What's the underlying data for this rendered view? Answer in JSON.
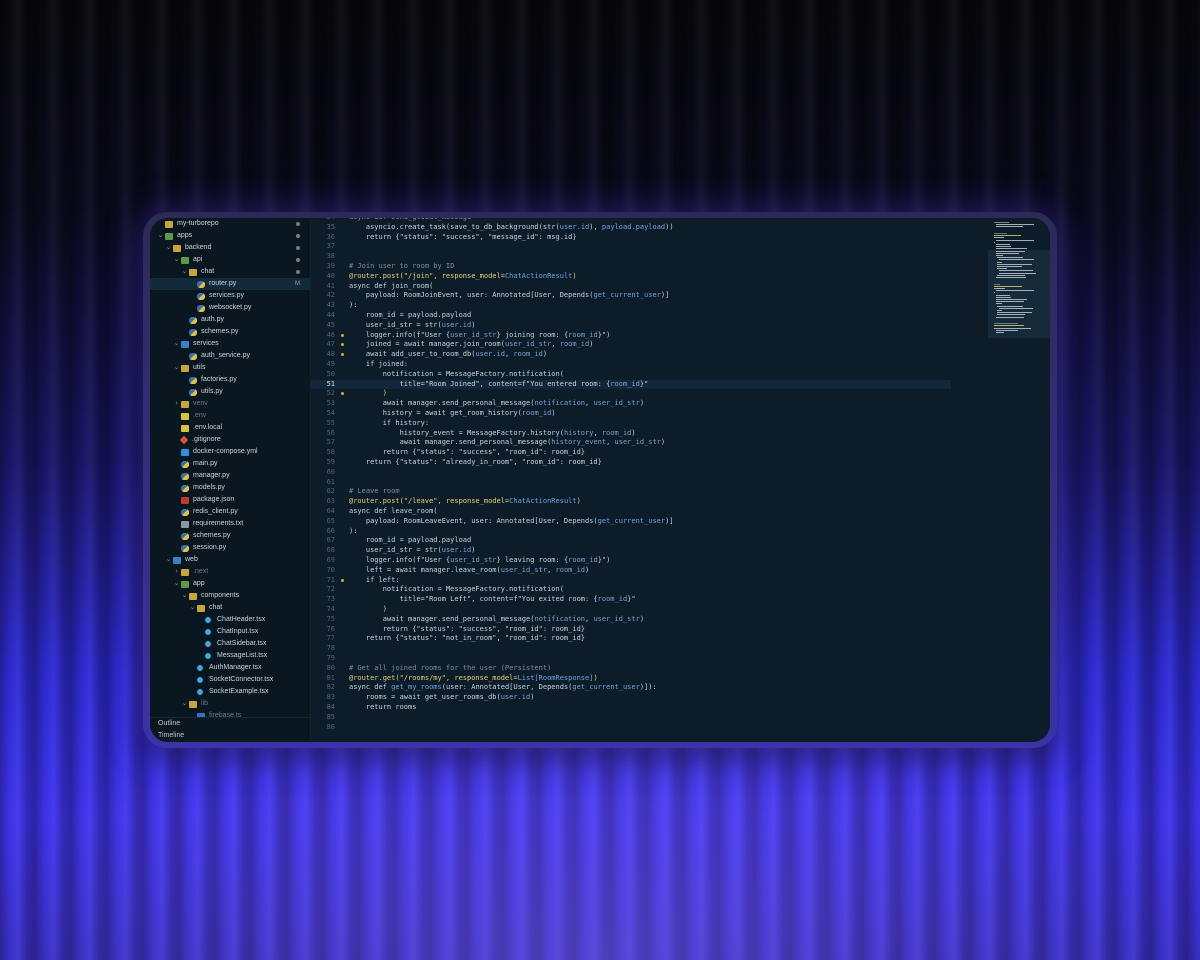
{
  "explorer": {
    "items": [
      {
        "label": "my-turborepo",
        "depth": 0,
        "chev": "",
        "icon": "ic-folder",
        "dot": true
      },
      {
        "label": "apps",
        "depth": 0,
        "chev": "⌄",
        "icon": "ic-folder-g",
        "dot": true
      },
      {
        "label": "backend",
        "depth": 1,
        "chev": "⌄",
        "icon": "ic-folder",
        "dot": true
      },
      {
        "label": "api",
        "depth": 2,
        "chev": "⌄",
        "icon": "ic-folder-g",
        "dot": true
      },
      {
        "label": "chat",
        "depth": 3,
        "chev": "⌄",
        "icon": "ic-folder",
        "dot": true
      },
      {
        "label": "router.py",
        "depth": 4,
        "chev": "",
        "icon": "ic-py",
        "badge": "M",
        "selected": true
      },
      {
        "label": "services.py",
        "depth": 4,
        "chev": "",
        "icon": "ic-py"
      },
      {
        "label": "websocket.py",
        "depth": 4,
        "chev": "",
        "icon": "ic-py"
      },
      {
        "label": "auth.py",
        "depth": 3,
        "chev": "",
        "icon": "ic-py"
      },
      {
        "label": "schemes.py",
        "depth": 3,
        "chev": "",
        "icon": "ic-py"
      },
      {
        "label": "services",
        "depth": 2,
        "chev": "⌄",
        "icon": "ic-folder-b"
      },
      {
        "label": "auth_service.py",
        "depth": 3,
        "chev": "",
        "icon": "ic-py"
      },
      {
        "label": "utils",
        "depth": 2,
        "chev": "⌄",
        "icon": "ic-folder"
      },
      {
        "label": "factories.py",
        "depth": 3,
        "chev": "",
        "icon": "ic-py"
      },
      {
        "label": "utils.py",
        "depth": 3,
        "chev": "",
        "icon": "ic-py"
      },
      {
        "label": "venv",
        "depth": 2,
        "chev": "›",
        "icon": "ic-folder",
        "dim": true
      },
      {
        "label": ".env",
        "depth": 2,
        "chev": "",
        "icon": "ic-env",
        "dim": true
      },
      {
        "label": ".env.local",
        "depth": 2,
        "chev": "",
        "icon": "ic-env"
      },
      {
        "label": ".gitignore",
        "depth": 2,
        "chev": "",
        "icon": "ic-git"
      },
      {
        "label": "docker-compose.yml",
        "depth": 2,
        "chev": "",
        "icon": "ic-docker"
      },
      {
        "label": "main.py",
        "depth": 2,
        "chev": "",
        "icon": "ic-py"
      },
      {
        "label": "manager.py",
        "depth": 2,
        "chev": "",
        "icon": "ic-py"
      },
      {
        "label": "models.py",
        "depth": 2,
        "chev": "",
        "icon": "ic-py"
      },
      {
        "label": "package.json",
        "depth": 2,
        "chev": "",
        "icon": "ic-json"
      },
      {
        "label": "redis_client.py",
        "depth": 2,
        "chev": "",
        "icon": "ic-py"
      },
      {
        "label": "requirements.txt",
        "depth": 2,
        "chev": "",
        "icon": "ic-txt"
      },
      {
        "label": "schemes.py",
        "depth": 2,
        "chev": "",
        "icon": "ic-py"
      },
      {
        "label": "session.py",
        "depth": 2,
        "chev": "",
        "icon": "ic-py"
      },
      {
        "label": "web",
        "depth": 1,
        "chev": "⌄",
        "icon": "ic-folder-b"
      },
      {
        "label": ".next",
        "depth": 2,
        "chev": "›",
        "icon": "ic-folder",
        "dim": true
      },
      {
        "label": "app",
        "depth": 2,
        "chev": "⌄",
        "icon": "ic-folder-g"
      },
      {
        "label": "components",
        "depth": 3,
        "chev": "⌄",
        "icon": "ic-folder"
      },
      {
        "label": "chat",
        "depth": 4,
        "chev": "⌄",
        "icon": "ic-folder"
      },
      {
        "label": "ChatHeader.tsx",
        "depth": 5,
        "chev": "",
        "icon": "ic-tsx"
      },
      {
        "label": "ChatInput.tsx",
        "depth": 5,
        "chev": "",
        "icon": "ic-tsx"
      },
      {
        "label": "ChatSidebar.tsx",
        "depth": 5,
        "chev": "",
        "icon": "ic-tsx"
      },
      {
        "label": "MessageList.tsx",
        "depth": 5,
        "chev": "",
        "icon": "ic-tsx"
      },
      {
        "label": "AuthManager.tsx",
        "depth": 4,
        "chev": "",
        "icon": "ic-tsx"
      },
      {
        "label": "SocketConnector.tsx",
        "depth": 4,
        "chev": "",
        "icon": "ic-tsx"
      },
      {
        "label": "SocketExample.tsx",
        "depth": 4,
        "chev": "",
        "icon": "ic-tsx"
      },
      {
        "label": "lib",
        "depth": 3,
        "chev": "⌄",
        "icon": "ic-folder",
        "dim": true
      },
      {
        "label": "firebase.ts",
        "depth": 4,
        "chev": "",
        "icon": "ic-ts",
        "dim": true
      }
    ],
    "footer": [
      "Outline",
      "Timeline"
    ]
  },
  "editor": {
    "current_line": 51,
    "lines": [
      {
        "n": "34",
        "segs": [
          [
            "async def send_global_message",
            "#8fa0ad"
          ]
        ]
      },
      {
        "n": "35",
        "segs": [
          [
            "    asyncio.create_task(save_to_db_background(",
            "#c8d3dc"
          ],
          [
            "str",
            "#c8d3dc"
          ],
          [
            "(",
            "#c8d3dc"
          ],
          [
            "user.id",
            "#7aa2d8"
          ],
          [
            "), ",
            "#c8d3dc"
          ],
          [
            "payload.payload",
            "#7aa2d8"
          ],
          [
            "))",
            "#c8d3dc"
          ]
        ]
      },
      {
        "n": "36",
        "segs": [
          [
            "    return {\"status\": \"success\", \"message_id\": msg.id}",
            "#c8d3dc"
          ]
        ]
      },
      {
        "n": "37",
        "segs": []
      },
      {
        "n": "38",
        "segs": []
      },
      {
        "n": "39",
        "segs": [
          [
            "# Join user to room by ID",
            "#7c8d9a"
          ]
        ]
      },
      {
        "n": "40",
        "segs": [
          [
            "@router.post(\"/join\", response_model=",
            "#e6d27a"
          ],
          [
            "ChatActionResult",
            "#6fa3e0"
          ],
          [
            ")",
            "#e6d27a"
          ]
        ]
      },
      {
        "n": "41",
        "segs": [
          [
            "async def join_room(",
            "#c8d3dc"
          ]
        ]
      },
      {
        "n": "42",
        "segs": [
          [
            "    payload: RoomJoinEvent, user: Annotated[User, Depends(",
            "#c8d3dc"
          ],
          [
            "get_current_user",
            "#6fa3e0"
          ],
          [
            ")]",
            "#c8d3dc"
          ]
        ]
      },
      {
        "n": "43",
        "segs": [
          [
            "):",
            "#c8d3dc"
          ]
        ]
      },
      {
        "n": "44",
        "segs": [
          [
            "    room_id = payload.payload",
            "#c8d3dc"
          ]
        ]
      },
      {
        "n": "45",
        "segs": [
          [
            "    user_id_str = ",
            "#c8d3dc"
          ],
          [
            "str",
            "#c8d3dc"
          ],
          [
            "(",
            "#c8d3dc"
          ],
          [
            "user.id",
            "#7aa2d8"
          ],
          [
            ")",
            "#c8d3dc"
          ]
        ]
      },
      {
        "n": "46",
        "segs": [
          [
            "    logger.info(f\"User {",
            "#c8d3dc"
          ],
          [
            "user_id_str",
            "#7aa2d8"
          ],
          [
            "} joining room: {",
            "#c8d3dc"
          ],
          [
            "room_id",
            "#7aa2d8"
          ],
          [
            "}\")",
            "#c8d3dc"
          ]
        ]
      },
      {
        "n": "47",
        "segs": [
          [
            "    joined = await manager.join_room(",
            "#c8d3dc"
          ],
          [
            "user_id_str",
            "#7aa2d8"
          ],
          [
            ", ",
            "#c8d3dc"
          ],
          [
            "room_id",
            "#7aa2d8"
          ],
          [
            ")",
            "#c8d3dc"
          ]
        ]
      },
      {
        "n": "48",
        "segs": [
          [
            "    await add_user_to_room_db(",
            "#c8d3dc"
          ],
          [
            "user.id",
            "#7aa2d8"
          ],
          [
            ", ",
            "#c8d3dc"
          ],
          [
            "room_id",
            "#7aa2d8"
          ],
          [
            ")",
            "#c8d3dc"
          ]
        ]
      },
      {
        "n": "49",
        "segs": [
          [
            "    if joined:",
            "#c8d3dc"
          ]
        ]
      },
      {
        "n": "50",
        "segs": [
          [
            "        notification = MessageFactory.notification(",
            "#c8d3dc"
          ]
        ]
      },
      {
        "n": "51",
        "segs": [
          [
            "            title=\"Room Joined\", content=f\"You entered room: {",
            "#c8d3dc"
          ],
          [
            "room_id",
            "#7aa2d8"
          ],
          [
            "}\"",
            "#c8d3dc"
          ]
        ]
      },
      {
        "n": "52",
        "segs": [
          [
            "        )",
            "#e6d27a"
          ]
        ]
      },
      {
        "n": "53",
        "segs": [
          [
            "        await manager.send_personal_message(",
            "#c8d3dc"
          ],
          [
            "notification",
            "#7aa2d8"
          ],
          [
            ", ",
            "#c8d3dc"
          ],
          [
            "user_id_str",
            "#7aa2d8"
          ],
          [
            ")",
            "#c8d3dc"
          ]
        ]
      },
      {
        "n": "54",
        "segs": [
          [
            "        history = await get_room_history(",
            "#c8d3dc"
          ],
          [
            "room_id",
            "#7aa2d8"
          ],
          [
            ")",
            "#c8d3dc"
          ]
        ]
      },
      {
        "n": "55",
        "segs": [
          [
            "        if history:",
            "#c8d3dc"
          ]
        ]
      },
      {
        "n": "56",
        "segs": [
          [
            "            history_event = MessageFactory.history(",
            "#c8d3dc"
          ],
          [
            "history",
            "#7aa2d8"
          ],
          [
            ", ",
            "#c8d3dc"
          ],
          [
            "room_id",
            "#7aa2d8"
          ],
          [
            ")",
            "#c8d3dc"
          ]
        ]
      },
      {
        "n": "57",
        "segs": [
          [
            "            await manager.send_personal_message(",
            "#c8d3dc"
          ],
          [
            "history_event",
            "#7aa2d8"
          ],
          [
            ", ",
            "#c8d3dc"
          ],
          [
            "user_id_str",
            "#7aa2d8"
          ],
          [
            ")",
            "#c8d3dc"
          ]
        ]
      },
      {
        "n": "58",
        "segs": [
          [
            "        return {\"status\": \"success\", \"room_id\": room_id}",
            "#c8d3dc"
          ]
        ]
      },
      {
        "n": "59",
        "segs": [
          [
            "    return {\"status\": \"already_in_room\", \"room_id\": room_id}",
            "#c8d3dc"
          ]
        ]
      },
      {
        "n": "60",
        "segs": []
      },
      {
        "n": "61",
        "segs": []
      },
      {
        "n": "62",
        "segs": [
          [
            "# Leave room",
            "#7c8d9a"
          ]
        ]
      },
      {
        "n": "63",
        "segs": [
          [
            "@router.post(\"/leave\", response_model=",
            "#e6d27a"
          ],
          [
            "ChatActionResult",
            "#6fa3e0"
          ],
          [
            ")",
            "#e6d27a"
          ]
        ]
      },
      {
        "n": "64",
        "segs": [
          [
            "async def leave_room(",
            "#c8d3dc"
          ]
        ]
      },
      {
        "n": "65",
        "segs": [
          [
            "    payload: RoomLeaveEvent, user: Annotated[User, Depends(",
            "#c8d3dc"
          ],
          [
            "get_current_user",
            "#6fa3e0"
          ],
          [
            ")]",
            "#c8d3dc"
          ]
        ]
      },
      {
        "n": "66",
        "segs": [
          [
            "):",
            "#c8d3dc"
          ]
        ]
      },
      {
        "n": "67",
        "segs": [
          [
            "    room_id = payload.payload",
            "#c8d3dc"
          ]
        ]
      },
      {
        "n": "68",
        "segs": [
          [
            "    user_id_str = ",
            "#c8d3dc"
          ],
          [
            "str",
            "#c8d3dc"
          ],
          [
            "(",
            "#c8d3dc"
          ],
          [
            "user.id",
            "#7aa2d8"
          ],
          [
            ")",
            "#c8d3dc"
          ]
        ]
      },
      {
        "n": "69",
        "segs": [
          [
            "    logger.info(f\"User {",
            "#c8d3dc"
          ],
          [
            "user_id_str",
            "#7aa2d8"
          ],
          [
            "} leaving room: {",
            "#c8d3dc"
          ],
          [
            "room_id",
            "#7aa2d8"
          ],
          [
            "}\")",
            "#c8d3dc"
          ]
        ]
      },
      {
        "n": "70",
        "segs": [
          [
            "    left = await manager.leave_room(",
            "#c8d3dc"
          ],
          [
            "user_id_str",
            "#7aa2d8"
          ],
          [
            ", ",
            "#c8d3dc"
          ],
          [
            "room_id",
            "#7aa2d8"
          ],
          [
            ")",
            "#c8d3dc"
          ]
        ]
      },
      {
        "n": "71",
        "segs": [
          [
            "    if left:",
            "#c8d3dc"
          ]
        ]
      },
      {
        "n": "72",
        "segs": [
          [
            "        notification = MessageFactory.notification(",
            "#c8d3dc"
          ]
        ]
      },
      {
        "n": "73",
        "segs": [
          [
            "            title=\"Room Left\", content=f\"You exited room: {",
            "#c8d3dc"
          ],
          [
            "room_id",
            "#7aa2d8"
          ],
          [
            "}\"",
            "#c8d3dc"
          ]
        ]
      },
      {
        "n": "74",
        "segs": [
          [
            "        )",
            "#e6d27a"
          ]
        ]
      },
      {
        "n": "75",
        "segs": [
          [
            "        await manager.send_personal_message(",
            "#c8d3dc"
          ],
          [
            "notification",
            "#7aa2d8"
          ],
          [
            ", ",
            "#c8d3dc"
          ],
          [
            "user_id_str",
            "#7aa2d8"
          ],
          [
            ")",
            "#c8d3dc"
          ]
        ]
      },
      {
        "n": "76",
        "segs": [
          [
            "        return {\"status\": \"success\", \"room_id\": room_id}",
            "#c8d3dc"
          ]
        ]
      },
      {
        "n": "77",
        "segs": [
          [
            "    return {\"status\": \"not_in_room\", \"room_id\": room_id}",
            "#c8d3dc"
          ]
        ]
      },
      {
        "n": "78",
        "segs": []
      },
      {
        "n": "79",
        "segs": []
      },
      {
        "n": "80",
        "segs": [
          [
            "# Get all joined rooms for the user (Persistent)",
            "#7c8d9a"
          ]
        ]
      },
      {
        "n": "81",
        "segs": [
          [
            "@router.get(\"/rooms/my\", response_model=",
            "#e6d27a"
          ],
          [
            "List[RoomResponse]",
            "#6fa3e0"
          ],
          [
            ")",
            "#e6d27a"
          ]
        ]
      },
      {
        "n": "82",
        "segs": [
          [
            "async def ",
            "#c8d3dc"
          ],
          [
            "get_my_rooms",
            "#6fa3e0"
          ],
          [
            "(user: Annotated[User, Depends(",
            "#c8d3dc"
          ],
          [
            "get_current_user",
            "#6fa3e0"
          ],
          [
            ")]):",
            "#c8d3dc"
          ]
        ]
      },
      {
        "n": "83",
        "segs": [
          [
            "    rooms = await get_user_rooms_db(",
            "#c8d3dc"
          ],
          [
            "user.id",
            "#7aa2d8"
          ],
          [
            ")",
            "#c8d3dc"
          ]
        ]
      },
      {
        "n": "84",
        "segs": [
          [
            "    return rooms",
            "#c8d3dc"
          ]
        ]
      },
      {
        "n": "85",
        "segs": []
      },
      {
        "n": "86",
        "segs": []
      }
    ],
    "change_markers": [
      "46",
      "47",
      "48",
      "52",
      "71"
    ]
  },
  "colors": {
    "background_glow": "#4034f0",
    "editor_bg": "#0c1c28",
    "sidebar_bg": "#0a1720",
    "selection": "#132a3b"
  }
}
